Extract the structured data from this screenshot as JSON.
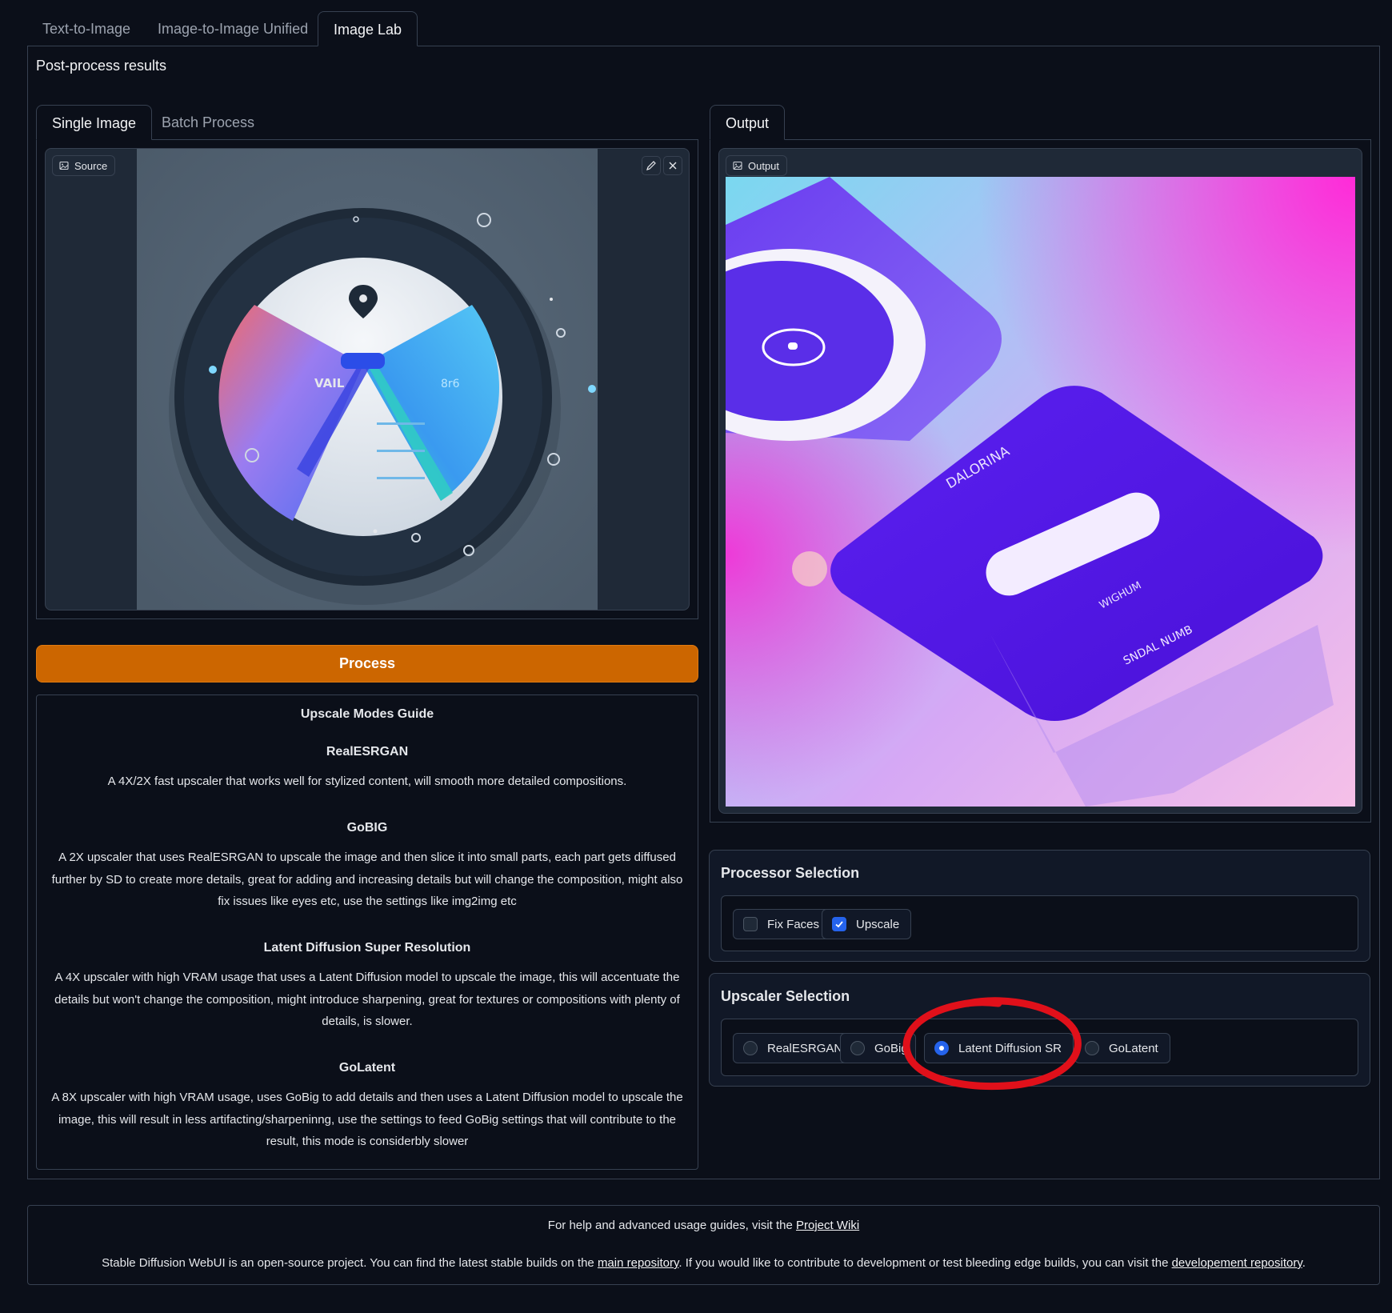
{
  "top_tabs": [
    "Text-to-Image",
    "Image-to-Image Unified",
    "Image Lab"
  ],
  "section_title": "Post-process results",
  "left_tabs": [
    "Single Image",
    "Batch Process"
  ],
  "source_label": "Source",
  "right_tabs": [
    "Output"
  ],
  "output_label": "Output",
  "process_button": "Process",
  "guide": {
    "title": "Upscale Modes Guide",
    "realesrgan_title": "RealESRGAN",
    "realesrgan_text": "A 4X/2X fast upscaler that works well for stylized content, will smooth more detailed compositions.",
    "gobig_title": "GoBIG",
    "gobig_text": "A 2X upscaler that uses RealESRGAN to upscale the image and then slice it into small parts, each part gets diffused further by SD to create more details, great for adding and increasing details but will change the composition, might also fix issues like eyes etc, use the settings like img2img etc",
    "ldsr_title": "Latent Diffusion Super Resolution",
    "ldsr_text": "A 4X upscaler with high VRAM usage that uses a Latent Diffusion model to upscale the image, this will accentuate the details but won't change the composition, might introduce sharpening, great for textures or compositions with plenty of details, is slower.",
    "golatent_title": "GoLatent",
    "golatent_text": "A 8X upscaler with high VRAM usage, uses GoBig to add details and then uses a Latent Diffusion model to upscale the image, this will result in less artifacting/sharpeninng, use the settings to feed GoBig settings that will contribute to the result, this mode is considerbly slower"
  },
  "processor": {
    "title": "Processor Selection",
    "options": [
      {
        "label": "Fix Faces",
        "checked": false
      },
      {
        "label": "Upscale",
        "checked": true
      }
    ]
  },
  "upscaler": {
    "title": "Upscaler Selection",
    "options": [
      {
        "label": "RealESRGAN",
        "selected": false
      },
      {
        "label": "GoBig",
        "selected": false
      },
      {
        "label": "Latent Diffusion SR",
        "selected": true
      },
      {
        "label": "GoLatent",
        "selected": false
      }
    ]
  },
  "footer": {
    "line1_text": "For help and advanced usage guides, visit the ",
    "line1_link": "Project Wiki",
    "line2_text_a": "Stable Diffusion WebUI is an open-source project. You can find the latest stable builds on the ",
    "line2_link_a": "main repository",
    "line2_text_b": ". If you would like to contribute to development or test bleeding edge builds, you can visit the ",
    "line2_link_b": "developement repository",
    "line2_text_c": "."
  },
  "colors": {
    "background": "#0b0f19",
    "process_button": "#cc6600",
    "accent_blue": "#2563eb",
    "annotation_red": "#e0101a"
  }
}
